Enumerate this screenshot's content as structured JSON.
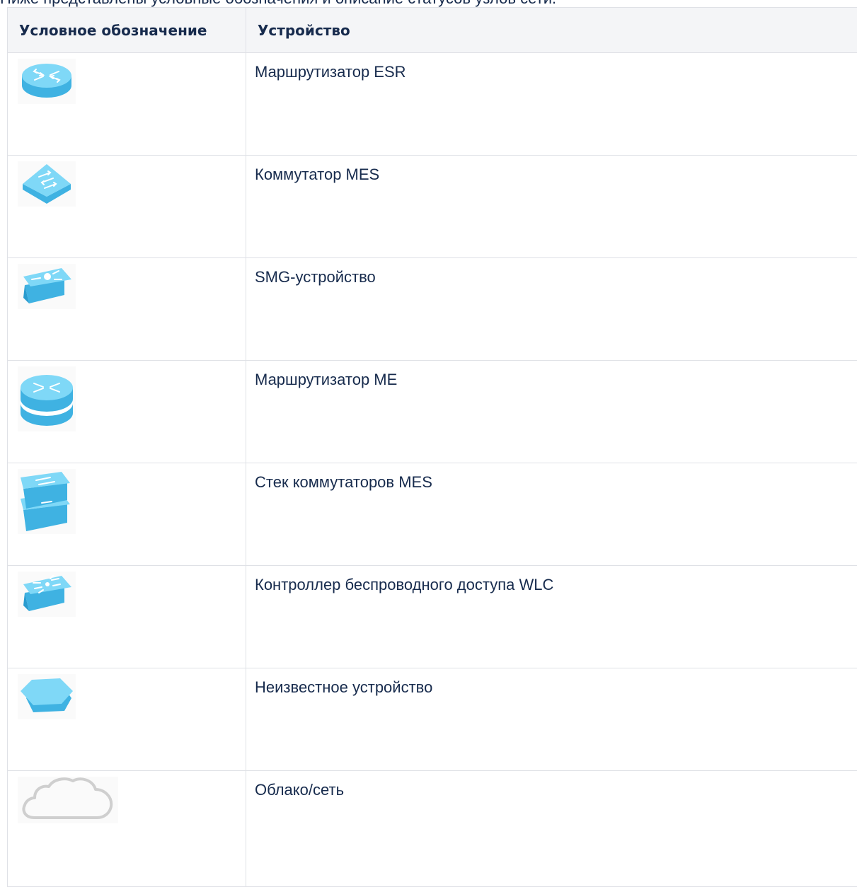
{
  "intro_text": "Ниже представлены условные обозначения и описание статусов узлов сети.",
  "table": {
    "headers": [
      "Условное обозначение",
      "Устройство"
    ],
    "rows": [
      {
        "icon": "router-esr-icon",
        "label": "Маршрутизатор ESR"
      },
      {
        "icon": "switch-mes-icon",
        "label": "Коммутатор MES"
      },
      {
        "icon": "smg-device-icon",
        "label": "SMG-устройство"
      },
      {
        "icon": "router-me-icon",
        "label": "Маршрутизатор ME"
      },
      {
        "icon": "switch-stack-icon",
        "label": "Стек коммутаторов MES"
      },
      {
        "icon": "wlc-controller-icon",
        "label": "Контроллер беспроводного доступа WLC"
      },
      {
        "icon": "unknown-device-icon",
        "label": "Неизвестное устройство"
      },
      {
        "icon": "cloud-network-icon",
        "label": "Облако/сеть"
      }
    ]
  },
  "colors": {
    "device_top": "#7fd8f7",
    "device_side": "#3fb2e2",
    "cloud_stroke": "#cfcfcf",
    "border": "#dfe1e6",
    "header_bg": "#f4f5f7"
  }
}
